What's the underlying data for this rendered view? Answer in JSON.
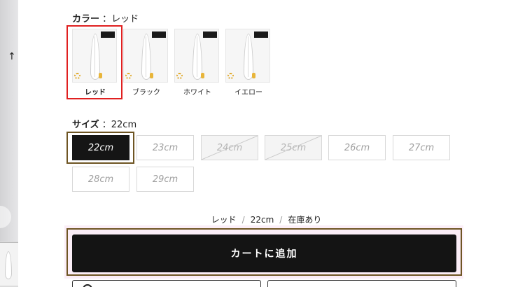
{
  "color_section": {
    "label": "カラー",
    "selected": "：レッド",
    "swatches": [
      {
        "name": "レッド",
        "selected": true
      },
      {
        "name": "ブラック",
        "selected": false
      },
      {
        "name": "ホワイト",
        "selected": false
      },
      {
        "name": "イエロー",
        "selected": false
      }
    ]
  },
  "size_section": {
    "label": "サイズ",
    "selected": "：22cm",
    "sizes": [
      {
        "label": "22cm",
        "state": "selected"
      },
      {
        "label": "23cm",
        "state": "available"
      },
      {
        "label": "24cm",
        "state": "soldout"
      },
      {
        "label": "25cm",
        "state": "soldout"
      },
      {
        "label": "26cm",
        "state": "available"
      },
      {
        "label": "27cm",
        "state": "available"
      },
      {
        "label": "28cm",
        "state": "available"
      },
      {
        "label": "29cm",
        "state": "available"
      }
    ]
  },
  "summary": {
    "color": "レッド",
    "separator": "/",
    "size": "22cm",
    "stock": "在庫あり"
  },
  "cart": {
    "add_label": "カートに追加"
  },
  "colors": {
    "selection_red": "#e02020",
    "selection_gold": "#6e5523",
    "cart_bg": "#141414"
  }
}
